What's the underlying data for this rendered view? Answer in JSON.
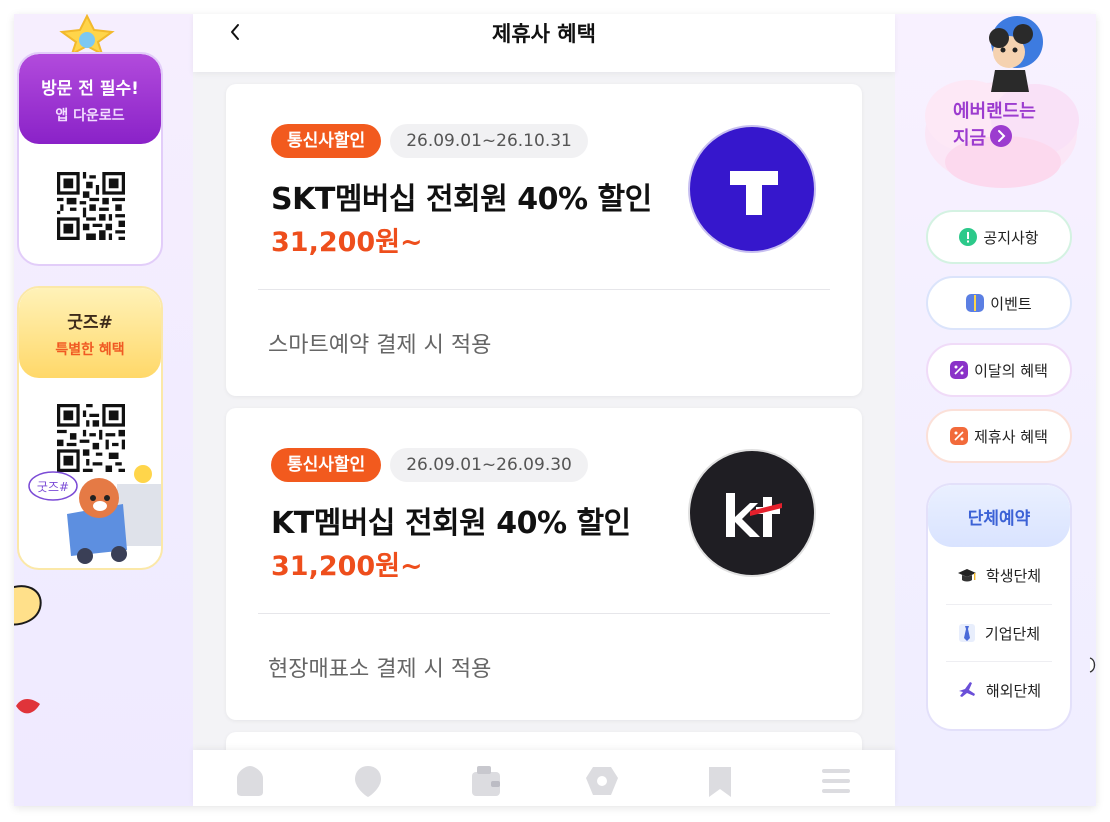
{
  "header": {
    "title": "제휴사 혜택",
    "back_glyph": "‹"
  },
  "left_promos": [
    {
      "title": "방문 전 필수!",
      "subtitle": "앱 다운로드"
    },
    {
      "title": "굿즈#",
      "subtitle": "특별한 혜택",
      "badge": "굿즈#"
    }
  ],
  "cards": [
    {
      "category": "통신사할인",
      "period": "26.09.01~26.10.31",
      "title": "SKT멤버십 전회원 40% 할인",
      "price": "31,200원~",
      "note": "스마트예약 결제 시 적용",
      "logo": "T"
    },
    {
      "category": "통신사할인",
      "period": "26.09.01~26.09.30",
      "title": "KT멤버십 전회원 40% 할인",
      "price": "31,200원~",
      "note": "현장매표소 결제 시 적용",
      "logo": "kt"
    }
  ],
  "right_panel": {
    "now_line1": "에버랜드는",
    "now_line2": "지금",
    "pills": [
      "공지사항",
      "이벤트",
      "이달의 혜택",
      "제휴사 혜택"
    ],
    "group": {
      "title": "단체예약",
      "items": [
        "학생단체",
        "기업단체",
        "해외단체"
      ]
    }
  },
  "bottom_nav": [
    "home-icon",
    "map-pin-icon",
    "wallet-icon",
    "reserve-icon",
    "bookmark-icon",
    "menu-icon"
  ],
  "colors": {
    "accent_orange": "#ee4e1c",
    "tmap_blue": "#3617cc",
    "kt_black": "#1f1e23",
    "purple": "#9c3ccf"
  }
}
